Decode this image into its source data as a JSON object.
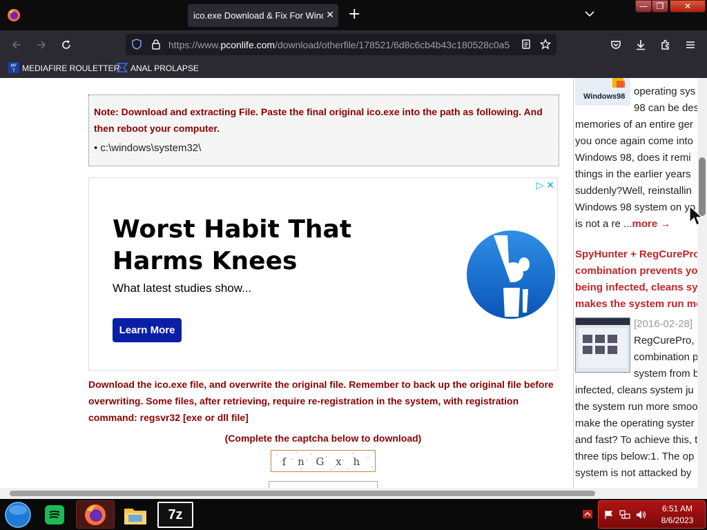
{
  "browser": {
    "tab_title": "ico.exe Download & Fix For Window",
    "url_prefix": "https://www.",
    "url_domain": "pconlife.com",
    "url_path": "/download/otherfile/178521/6d8c6cb4b43c180528c0a5",
    "bookmarks": [
      {
        "label": "MEDIAFIRE ROULETTER"
      },
      {
        "label": "ANAL PROLAPSE"
      }
    ]
  },
  "main": {
    "note": "Note: Download and extracting File. Paste the final original ico.exe into the path as following. And then reboot your computer.",
    "note_path": "• c:\\windows\\system32\\",
    "ad": {
      "headline": "Worst Habit That Harms Knees",
      "subtext": "What latest studies show...",
      "button": "Learn More"
    },
    "download_instructions": "Download the ico.exe file, and overwrite the original file. Remember to back up the original file before overwriting. Some files, after retrieving, require re-registration in the system, with registration command: regsvr32 [exe or dll file]",
    "captcha_label": "(Complete the captcha below to download)",
    "captcha_text": "f n G x h"
  },
  "sidebar": {
    "thumb1_label": "Windows98",
    "lines_a": [
      "operating sys",
      "98 can be des",
      "memories of an entire ger",
      "you once again come into",
      "Windows 98, does it remi",
      "things in the earlier years",
      "suddenly?Well, reinstallin",
      "Windows 98 system on yo"
    ],
    "more_prefix": "is not a re ...",
    "more_link": "more →",
    "article2_title_lines": [
      "SpyHunter + RegCurePro, t",
      "combination prevents you",
      "being infected, cleans syst",
      "makes the system run mor"
    ],
    "article2_date": "[2016-02-28]",
    "lines_b_short": [
      "RegCurePro, t",
      "combination p",
      "system from b"
    ],
    "lines_b": [
      "infected, cleans system ju",
      "the system run more smoo",
      "make the operating syster",
      "and fast? To achieve this, t",
      "three tips below:1. The op",
      "system is not attacked by"
    ]
  },
  "taskbar": {
    "time": "6:51 AM",
    "date": "8/6/2023",
    "sevenzip_label": "7z"
  },
  "colors": {
    "accent_red": "#8b0000",
    "link_red": "#c0252a",
    "ad_button": "#0a1fa6",
    "tray_red": "#b01414"
  }
}
